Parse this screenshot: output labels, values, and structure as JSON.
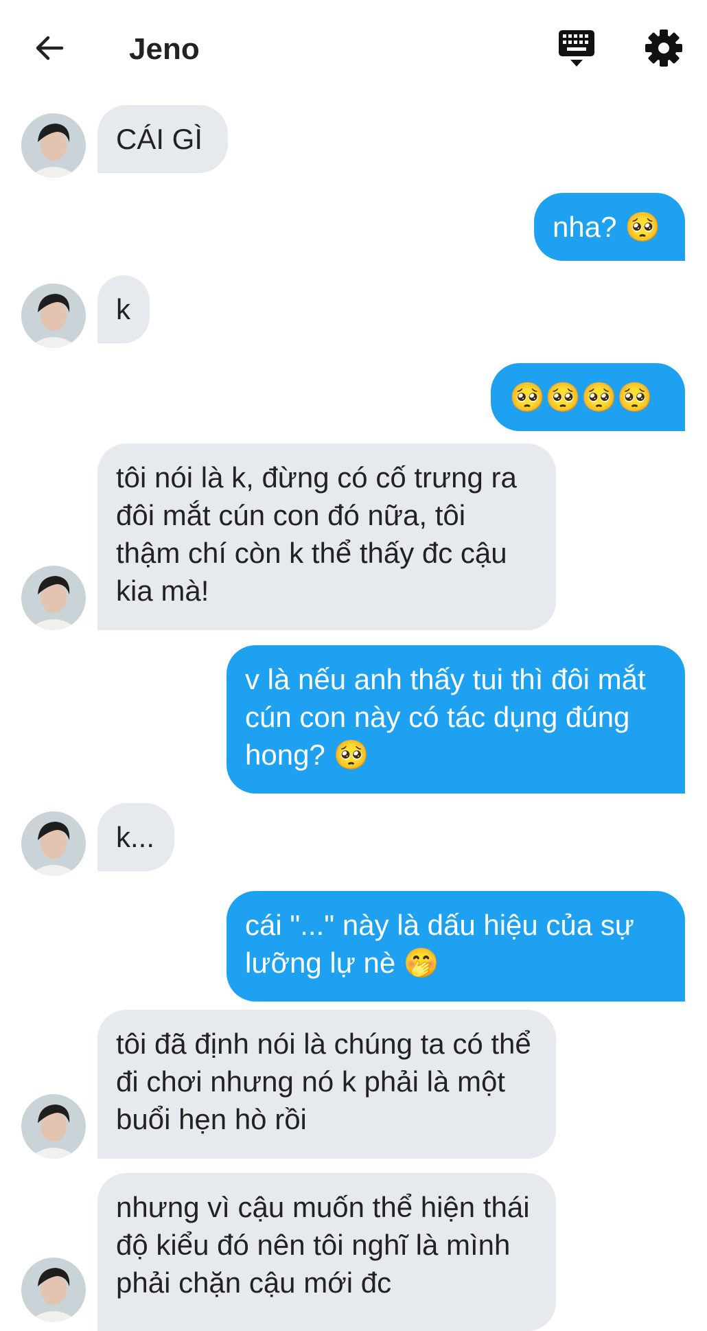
{
  "header": {
    "title": "Jeno"
  },
  "messages": [
    {
      "from": "them",
      "text": "CÁI GÌ"
    },
    {
      "from": "me",
      "text": "nha? 🥺"
    },
    {
      "from": "them",
      "text": "k"
    },
    {
      "from": "me",
      "text": "🥺🥺🥺🥺"
    },
    {
      "from": "them",
      "text": "tôi nói là k, đừng có cố trưng ra đôi mắt cún con đó nữa, tôi thậm chí còn k thể thấy đc cậu kia mà!"
    },
    {
      "from": "me",
      "text": "v là nếu anh thấy tui thì đôi mắt cún con này có tác dụng đúng hong? 🥺"
    },
    {
      "from": "them",
      "text": "k..."
    },
    {
      "from": "me",
      "text": "cái \"...\" này là dấu hiệu của sự lưỡng lự nè 🤭"
    },
    {
      "from": "them",
      "text": "tôi đã định nói là chúng ta có thể đi chơi nhưng nó k phải là một buổi hẹn hò rồi"
    },
    {
      "from": "them",
      "text": "nhưng vì cậu muốn thể hiện thái độ kiểu đó nên tôi nghĩ là mình phải chặn cậu mới đc"
    }
  ]
}
